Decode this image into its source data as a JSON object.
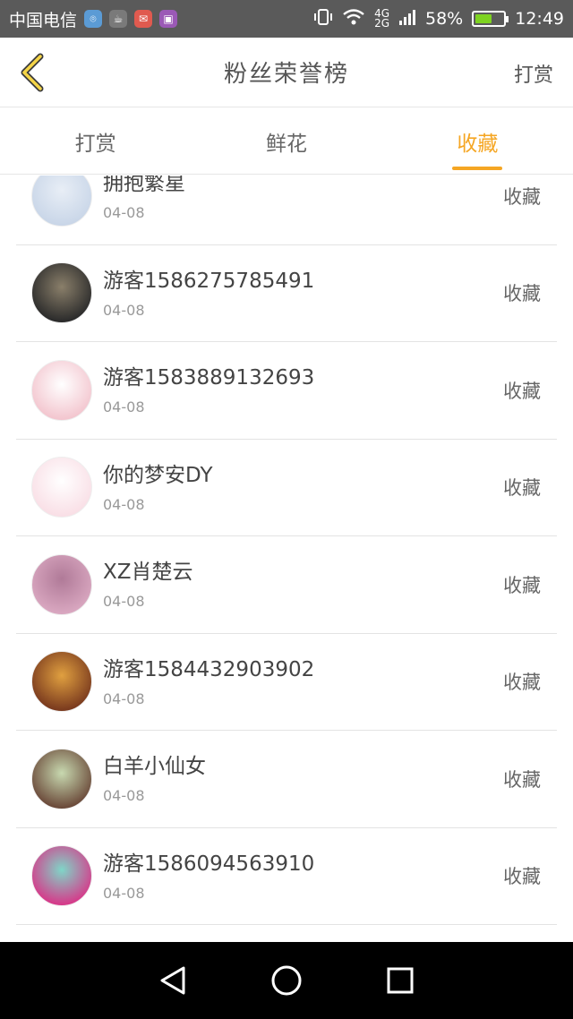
{
  "status_bar": {
    "carrier": "中国电信",
    "network_top": "4G",
    "network_bottom": "2G",
    "battery_percent": "58%",
    "battery_level": 0.58,
    "time": "12:49",
    "app_icons": [
      {
        "name": "location-app-icon",
        "color": "#5b9bd5"
      },
      {
        "name": "cup-app-icon",
        "color": "#7a7a7a"
      },
      {
        "name": "mail-app-icon",
        "color": "#e05a4f"
      },
      {
        "name": "gallery-app-icon",
        "color": "#9b59b6"
      }
    ]
  },
  "header": {
    "title": "粉丝荣誉榜",
    "action_label": "打赏",
    "back_icon": "chevron-left-icon",
    "accent_color": "#f5a623"
  },
  "tabs": [
    {
      "label": "打赏",
      "active": false
    },
    {
      "label": "鲜花",
      "active": false
    },
    {
      "label": "收藏",
      "active": true
    }
  ],
  "rows": [
    {
      "name": "拥抱繁星",
      "date": "04-08",
      "action": "收藏",
      "avatar_colors": [
        "#c9d6e8",
        "#e8eef6"
      ]
    },
    {
      "name": "游客1586275785491",
      "date": "04-08",
      "action": "收藏",
      "avatar_colors": [
        "#2b2b2b",
        "#8a7f6a"
      ]
    },
    {
      "name": "游客1583889132693",
      "date": "04-08",
      "action": "收藏",
      "avatar_colors": [
        "#f3c6cf",
        "#ffffff"
      ]
    },
    {
      "name": "你的梦安DY",
      "date": "04-08",
      "action": "收藏",
      "avatar_colors": [
        "#f9dfe6",
        "#ffffff"
      ]
    },
    {
      "name": "XZ肖楚云",
      "date": "04-08",
      "action": "收藏",
      "avatar_colors": [
        "#d9a7c0",
        "#b07a98"
      ]
    },
    {
      "name": "游客1584432903902",
      "date": "04-08",
      "action": "收藏",
      "avatar_colors": [
        "#7a3a1e",
        "#e0a040"
      ]
    },
    {
      "name": "白羊小仙女",
      "date": "04-08",
      "action": "收藏",
      "avatar_colors": [
        "#6b4a3a",
        "#c8d9b0"
      ]
    },
    {
      "name": "游客1586094563910",
      "date": "04-08",
      "action": "收藏",
      "avatar_colors": [
        "#d63a8a",
        "#7fd6c8"
      ]
    }
  ],
  "nav_bar": {
    "back_icon": "triangle-back-icon",
    "home_icon": "circle-home-icon",
    "recents_icon": "square-recents-icon"
  }
}
